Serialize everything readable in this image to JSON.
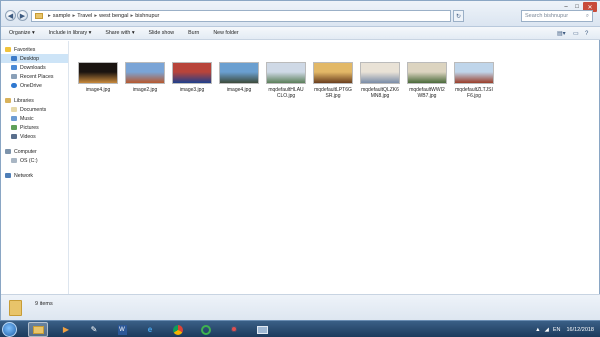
{
  "address": {
    "crumbs": [
      "sample",
      "Travel",
      "west bengal",
      "bishnupur"
    ]
  },
  "search": {
    "placeholder": "Search bishnupur"
  },
  "toolbar": {
    "organize": "Organize ▾",
    "include": "Include in library ▾",
    "share": "Share with ▾",
    "slideshow": "Slide show",
    "burn": "Burn",
    "newfolder": "New folder"
  },
  "sidebar": {
    "favorites": "Favorites",
    "desktop": "Desktop",
    "downloads": "Downloads",
    "recent": "Recent Places",
    "onedrive": "OneDrive",
    "libraries": "Libraries",
    "documents": "Documents",
    "music": "Music",
    "pictures": "Pictures",
    "videos": "Videos",
    "computer": "Computer",
    "osdrive": "OS (C:)",
    "network": "Network"
  },
  "files": [
    {
      "name": "image4.jpg",
      "colors": [
        "#1a1410",
        "#c98a3c"
      ]
    },
    {
      "name": "image2.jpg",
      "colors": [
        "#7aa4d6",
        "#b7582e"
      ]
    },
    {
      "name": "image3.jpg",
      "colors": [
        "#b8443a",
        "#1e3f8c"
      ]
    },
    {
      "name": "image4.jpg",
      "colors": [
        "#6a9fd0",
        "#3c4a3a"
      ]
    },
    {
      "name": "mqdefaultHLAU CLO.jpg",
      "colors": [
        "#cfd9e6",
        "#5b7f5a"
      ]
    },
    {
      "name": "mqdefaultLPT6G SR.jpg",
      "colors": [
        "#e2b867",
        "#6a3e1e"
      ]
    },
    {
      "name": "mqdefaultQLZK6 MN8.jpg",
      "colors": [
        "#e9e2d6",
        "#7a8ca8"
      ]
    },
    {
      "name": "mqdefaultWWI2 WB7.jpg",
      "colors": [
        "#dcd4c0",
        "#4a6a3a"
      ]
    },
    {
      "name": "mqdefaultZLTJSI F6.jpg",
      "colors": [
        "#bfd5ea",
        "#9a3e2a"
      ]
    }
  ],
  "status": {
    "count": "9 items"
  },
  "tray": {
    "lang": "EN",
    "time": "16/12/2018"
  },
  "colors": {
    "selection": "#cde4f7",
    "taskbar": "#1c3a5c"
  }
}
